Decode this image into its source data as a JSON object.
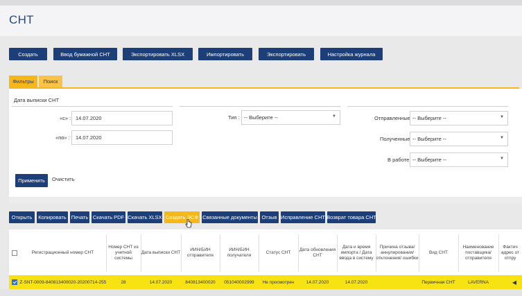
{
  "header": {
    "title": "СНТ"
  },
  "toolbar": {
    "buttons": [
      "Создать",
      "Ввод бумажной СНТ",
      "Экспортировать XLSX",
      "Импортировать",
      "Экспортировать",
      "Настройка журнала"
    ]
  },
  "tabs": [
    "Фильтры",
    "Поиск"
  ],
  "filters": {
    "date_label": "Дата выписки СНТ",
    "from_label": "«с» :",
    "from_value": "14.07.2020",
    "to_label": "«по» :",
    "to_value": "14.07.2020",
    "type_label": "Тип :",
    "type_value": "-- Выберите --",
    "sent_label": "Отправленные",
    "sent_value": "-- Выберите --",
    "received_label": "Полученные",
    "received_value": "-- Выберите --",
    "inwork_label": "В работе",
    "inwork_value": "-- Выберите --",
    "apply_label": "Применить",
    "clear_label": "Очистить"
  },
  "actions": [
    "Открыть",
    "Копировать",
    "Печать",
    "Скачать PDF",
    "Скачать XLSX",
    "Создать ЭСФ",
    "Связанные документы",
    "Отзыв",
    "Исправление СНТ",
    "Возврат товара СНТ"
  ],
  "table": {
    "columns": [
      "Регистрационный номер СНТ",
      "Номер СНТ из учетной системы",
      "Дата выписки СНТ",
      "ИИН/БИН отправителя",
      "ИИН/БИН получателя",
      "Статус СНТ",
      "Дата обновления СНТ",
      "Дата и время импорта / Дата ввода в систему",
      "Причина отзыва/ аннулирования/ отклонения/ ошибки",
      "Вид СНТ",
      "Наименование поставщика/ отправителя",
      "Фактич адрес от отпру"
    ],
    "rows": [
      {
        "checked": true,
        "cells": [
          "KZ-SNT-0009-840813400020-20200714-255..",
          "28",
          "14.07.2020",
          "840813400020",
          "051040002999",
          "Не просмотрен",
          "14.07.2020",
          "14.07.2020",
          "",
          "Первичная СНТ",
          "LAVERNA",
          ""
        ]
      }
    ]
  },
  "colors": {
    "primary": "#1c3f7a",
    "accent": "#f5b719",
    "row_highlight": "#f7e312"
  }
}
